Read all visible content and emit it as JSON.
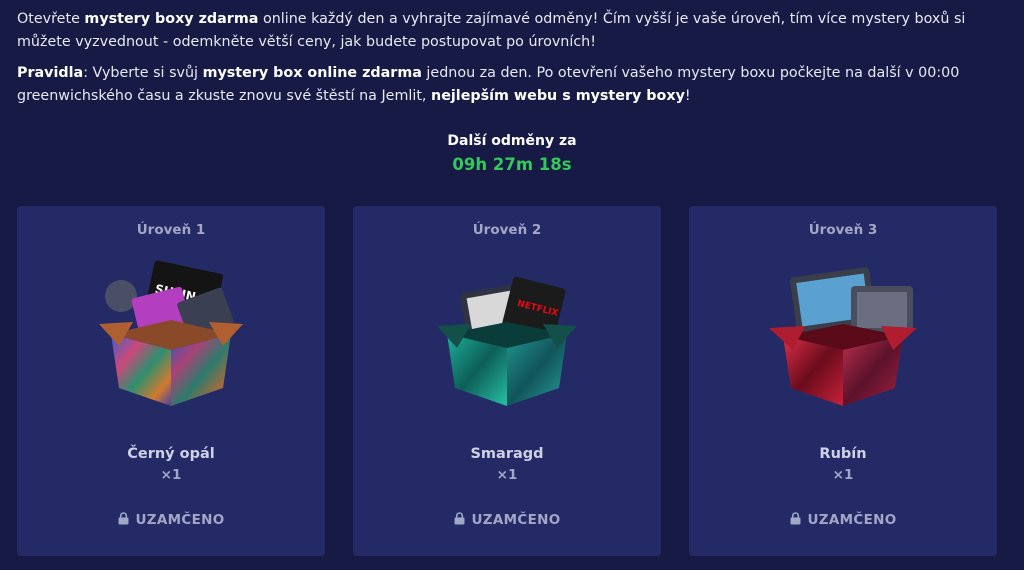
{
  "intro": {
    "p1": [
      {
        "t": "Otevřete ",
        "b": false
      },
      {
        "t": "mystery boxy zdarma",
        "b": true
      },
      {
        "t": " online každý den a vyhrajte zajímavé odměny! Čím vyšší je vaše úroveň, tím více mystery boxů si můžete vyzvednout - odemkněte větší ceny, jak budete postupovat po úrovních!",
        "b": false
      }
    ],
    "p2": [
      {
        "t": "Pravidla",
        "b": true
      },
      {
        "t": ": Vyberte si svůj ",
        "b": false
      },
      {
        "t": "mystery box online zdarma",
        "b": true
      },
      {
        "t": " jednou za den. Po otevření vašeho mystery boxu počkejte na další v 00:00 greenwichského času a zkuste znovu své štěstí na Jemlit, ",
        "b": false
      },
      {
        "t": "nejlepším webu s mystery boxy",
        "b": true
      },
      {
        "t": "!",
        "b": false
      }
    ]
  },
  "next_rewards": {
    "label": "Další odměny za",
    "timer": "09h 27m 18s",
    "timer_color": "#35c759"
  },
  "levels": [
    {
      "level": "Úroveň 1",
      "name": "Černý opál",
      "qty": "×1",
      "status": "UZAMČENO",
      "status_icon": "lock-icon",
      "box_theme": "opal",
      "card_art_text": "SHEIN"
    },
    {
      "level": "Úroveň 2",
      "name": "Smaragd",
      "qty": "×1",
      "status": "UZAMČENO",
      "status_icon": "lock-icon",
      "box_theme": "emerald",
      "card_art_text": "NETFLIX"
    },
    {
      "level": "Úroveň 3",
      "name": "Rubín",
      "qty": "×1",
      "status": "UZAMČENO",
      "status_icon": "lock-icon",
      "box_theme": "ruby",
      "card_art_text": ""
    }
  ],
  "colors": {
    "background": "#161a45",
    "card": "#242a66",
    "muted_text": "#a3a7c7",
    "accent_green": "#35c759"
  }
}
